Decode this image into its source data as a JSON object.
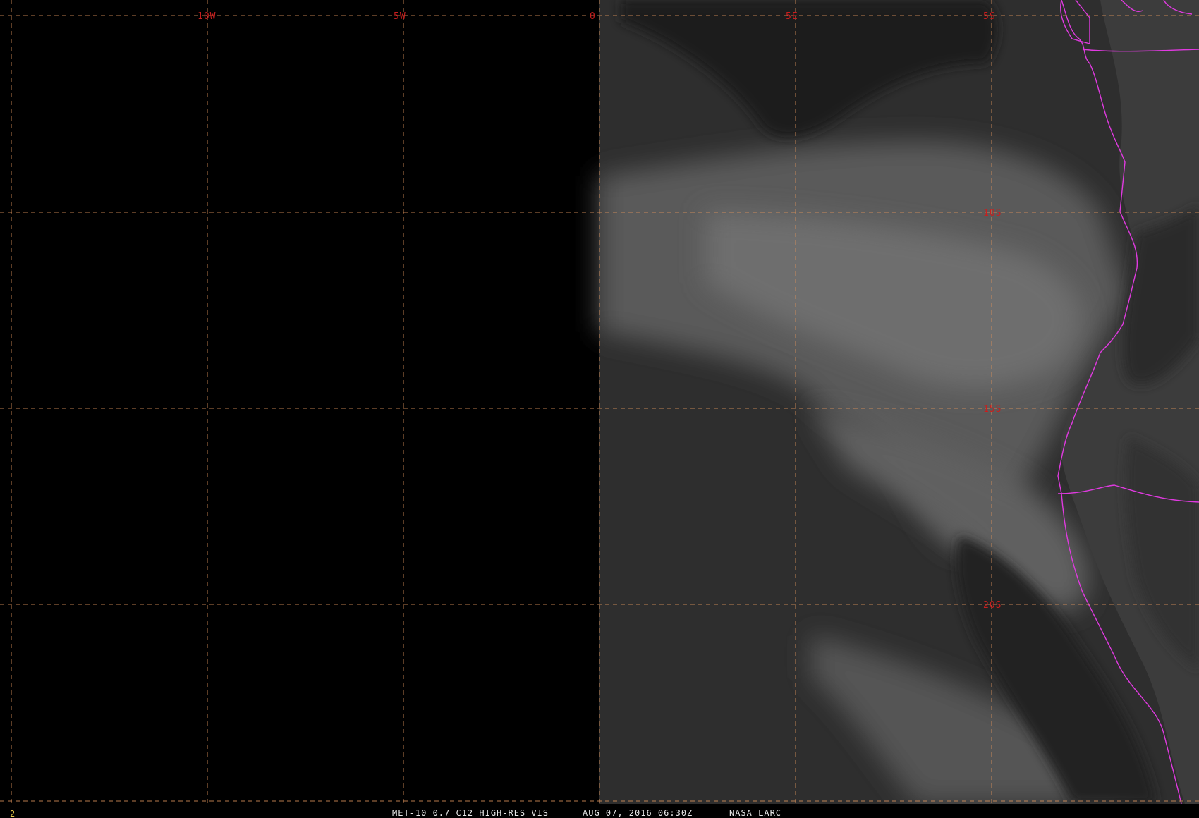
{
  "frame_number": "2",
  "status": {
    "product": "MET-10 0.7 C12 HIGH-RES VIS",
    "datetime": "AUG 07, 2016 06:30Z",
    "credit": "NASA LARC"
  },
  "grid": {
    "line_color": "#d9905a",
    "label_color": "#c81e1e",
    "longitude_labels": [
      "10W",
      "5W",
      "0",
      "5E"
    ],
    "latitude_labels": [
      "5S",
      "10S",
      "15S",
      "20S"
    ]
  },
  "boundaries": {
    "color": "#e03ae0"
  }
}
